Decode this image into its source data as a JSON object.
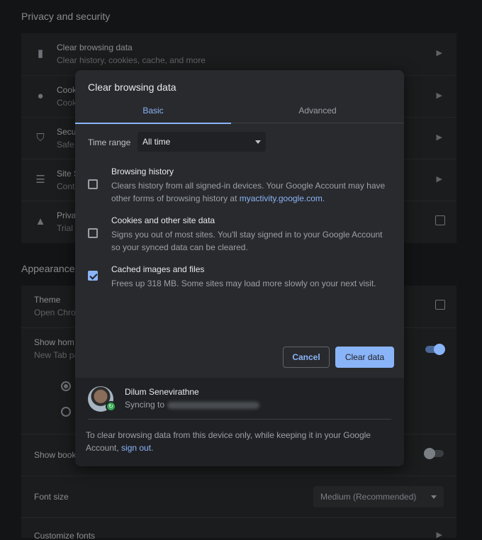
{
  "background": {
    "privacy_title": "Privacy and security",
    "privacy_rows": [
      {
        "title": "Clear browsing data",
        "subtitle": "Clear history, cookies, cache, and more"
      },
      {
        "title": "Cook",
        "subtitle": "Cook"
      },
      {
        "title": "Secu",
        "subtitle": "Safe"
      },
      {
        "title": "Site S",
        "subtitle": "Cont"
      },
      {
        "title": "Priva",
        "subtitle": "Trial"
      }
    ],
    "appearance_title": "Appearance",
    "theme": {
      "title": "Theme",
      "subtitle": "Open Chro"
    },
    "show_home": {
      "title": "Show hom",
      "subtitle": "New Tab pa"
    },
    "show_bookmarks": "Show book",
    "font_size": {
      "label": "Font size",
      "value": "Medium (Recommended)"
    },
    "customize_fonts": "Customize fonts"
  },
  "dialog": {
    "title": "Clear browsing data",
    "tabs": {
      "basic": "Basic",
      "advanced": "Advanced"
    },
    "time_range": {
      "label": "Time range",
      "value": "All time"
    },
    "options": [
      {
        "title": "Browsing history",
        "desc_before": "Clears history from all signed-in devices. Your Google Account may have other forms of browsing history at ",
        "link": "myactivity.google.com",
        "desc_after": ".",
        "checked": false
      },
      {
        "title": "Cookies and other site data",
        "desc": "Signs you out of most sites. You'll stay signed in to your Google Account so your synced data can be cleared.",
        "checked": false
      },
      {
        "title": "Cached images and files",
        "desc": "Frees up 318 MB. Some sites may load more slowly on your next visit.",
        "checked": true
      }
    ],
    "cancel_label": "Cancel",
    "clear_label": "Clear data",
    "account": {
      "name": "Dilum Senevirathne",
      "syncing_label": "Syncing to",
      "note_before": "To clear browsing data from this device only, while keeping it in your Google Account, ",
      "note_link": "sign out",
      "note_after": "."
    }
  },
  "colors": {
    "accent": "#8ab4f8",
    "dialog_bg": "#292a2d",
    "page_bg": "#131415"
  }
}
